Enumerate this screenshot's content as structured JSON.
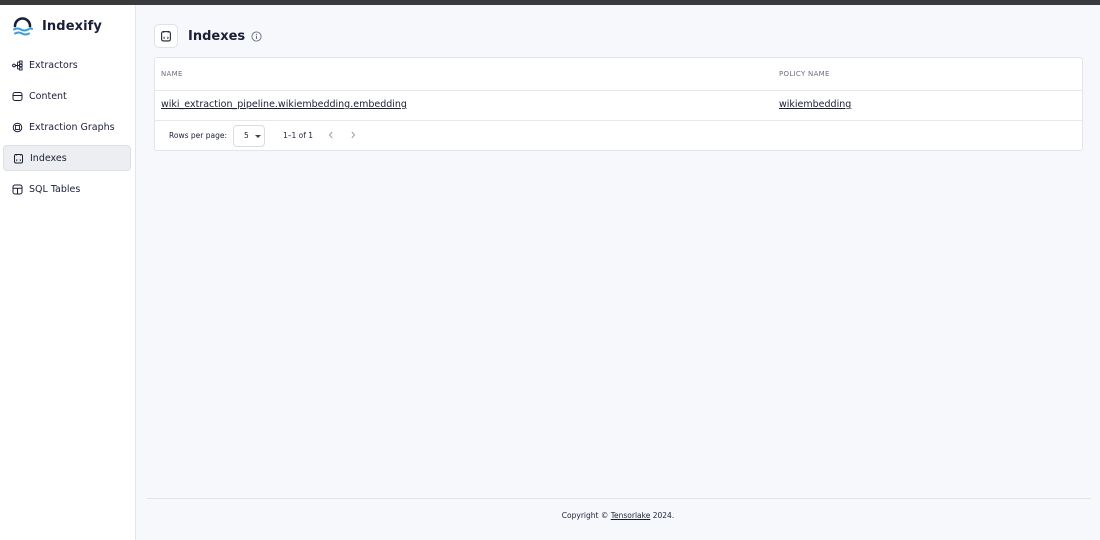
{
  "app": {
    "name": "Indexify"
  },
  "sidebar": {
    "items": [
      {
        "label": "Extractors",
        "icon": "branch-icon",
        "active": false
      },
      {
        "label": "Content",
        "icon": "database-icon",
        "active": false
      },
      {
        "label": "Extraction Graphs",
        "icon": "chip-icon",
        "active": false
      },
      {
        "label": "Indexes",
        "icon": "index-icon",
        "active": true
      },
      {
        "label": "SQL Tables",
        "icon": "table-icon",
        "active": false
      }
    ]
  },
  "page": {
    "title": "Indexes"
  },
  "table": {
    "columns": [
      "NAME",
      "POLICY NAME"
    ],
    "rows": [
      {
        "name": "wiki_extraction_pipeline.wikiembedding.embedding",
        "policy": "wikiembedding"
      }
    ]
  },
  "pagination": {
    "rows_per_page_label": "Rows per page:",
    "rows_per_page": "5",
    "range": "1–1 of 1"
  },
  "footer": {
    "prefix": "Copyright © ",
    "company": "Tensorlake",
    "suffix": " 2024."
  },
  "colors": {
    "logo_dark": "#1a1f36",
    "logo_accent": "#3b9ddd",
    "active_nav_bg": "#eceef2",
    "page_bg": "#f7f8fb"
  }
}
